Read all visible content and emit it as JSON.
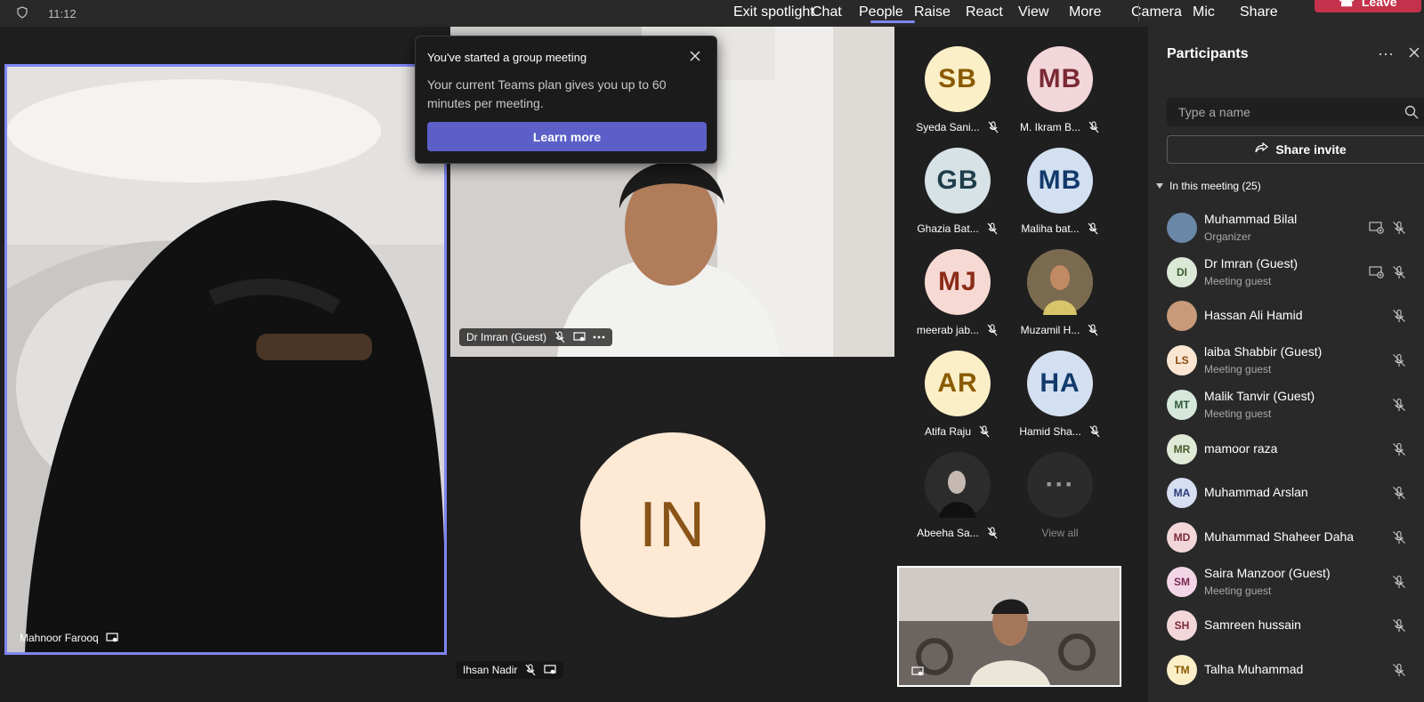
{
  "topbar": {
    "time": "11:12",
    "items": [
      "Exit spotlight",
      "Chat",
      "People",
      "Raise",
      "React",
      "View",
      "More",
      "Camera",
      "Mic",
      "Share"
    ],
    "active": "People",
    "leave_label": "Leave"
  },
  "popup": {
    "title": "You've started a group meeting",
    "body": "Your current Teams plan gives you up to 60 minutes per meeting.",
    "button": "Learn more"
  },
  "tiles": {
    "spotlight_name": "Mahnoor Farooq",
    "center_top_name": "Dr Imran (Guest)",
    "center_bottom_name": "Ihsan Nadir",
    "center_bottom_initials": "IN"
  },
  "grid": [
    {
      "initials": "SB",
      "label": "Syeda Sani...",
      "bg": "#fbefc7",
      "fg": "#8a5a00"
    },
    {
      "initials": "MB",
      "label": "M. Ikram B...",
      "bg": "#f2d6da",
      "fg": "#7a2a35"
    },
    {
      "initials": "GB",
      "label": "Ghazia Bat...",
      "bg": "#d6e2e6",
      "fg": "#1f3d4a"
    },
    {
      "initials": "MB",
      "label": "Maliha bat...",
      "bg": "#d3e0f2",
      "fg": "#123a6b"
    },
    {
      "initials": "MJ",
      "label": "meerab jab...",
      "bg": "#f7d9d3",
      "fg": "#8b2c18"
    },
    {
      "initials": "",
      "label": "Muzamil H...",
      "bg": "#7a6a4f",
      "fg": "#fff"
    },
    {
      "initials": "AR",
      "label": "Atifa Raju",
      "bg": "#fbefc7",
      "fg": "#8a5a00"
    },
    {
      "initials": "HA",
      "label": "Hamid Sha...",
      "bg": "#d3e0f2",
      "fg": "#123a6b"
    },
    {
      "initials": "",
      "label": "Abeeha Sa...",
      "bg": "#2c2c2c",
      "fg": "#fff"
    },
    {
      "initials": "···",
      "label": "View all",
      "bg": "#2b2b2b",
      "fg": "#9a9a9a"
    }
  ],
  "panel": {
    "title": "Participants",
    "search_placeholder": "Type a name",
    "share_invite": "Share invite",
    "section_label": "In this meeting (25)",
    "participants": [
      {
        "initials": "",
        "name": "Muhammad Bilal",
        "role": "Organizer",
        "bg": "#6a87a8",
        "fg": "#fff",
        "share": true
      },
      {
        "initials": "DI",
        "name": "Dr Imran (Guest)",
        "role": "Meeting guest",
        "bg": "#dbe8d6",
        "fg": "#3a5a2a",
        "share": true
      },
      {
        "initials": "",
        "name": "Hassan Ali Hamid",
        "role": "",
        "bg": "#c89a7a",
        "fg": "#fff",
        "share": false
      },
      {
        "initials": "LS",
        "name": "laiba Shabbir (Guest)",
        "role": "Meeting guest",
        "bg": "#fbe6d3",
        "fg": "#8a4a10",
        "share": false
      },
      {
        "initials": "MT",
        "name": "Malik Tanvir (Guest)",
        "role": "Meeting guest",
        "bg": "#d6e8dc",
        "fg": "#2a5a3a",
        "share": false
      },
      {
        "initials": "MR",
        "name": "mamoor raza",
        "role": "",
        "bg": "#e0e8d6",
        "fg": "#4a5a2a",
        "share": false
      },
      {
        "initials": "MA",
        "name": "Muhammad Arslan",
        "role": "",
        "bg": "#d6def2",
        "fg": "#2a3a7a",
        "share": false
      },
      {
        "initials": "MD",
        "name": "Muhammad Shaheer Daha",
        "role": "",
        "bg": "#f2d6da",
        "fg": "#7a2a35",
        "share": false
      },
      {
        "initials": "SM",
        "name": "Saira Manzoor (Guest)",
        "role": "Meeting guest",
        "bg": "#f2d6e6",
        "fg": "#7a2a55",
        "share": false
      },
      {
        "initials": "SH",
        "name": "Samreen hussain",
        "role": "",
        "bg": "#f2d6da",
        "fg": "#7a2a35",
        "share": false
      },
      {
        "initials": "TM",
        "name": "Talha Muhammad",
        "role": "",
        "bg": "#fbefc7",
        "fg": "#8a5a00",
        "share": false
      }
    ]
  }
}
